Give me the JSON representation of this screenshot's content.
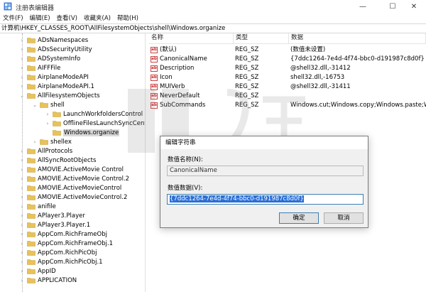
{
  "window": {
    "title": "注册表编辑器",
    "controls": {
      "minimize": "—",
      "maximize": "☐",
      "close": "✕"
    }
  },
  "menu": [
    "文件(F)",
    "编辑(E)",
    "查看(V)",
    "收藏夹(A)",
    "帮助(H)"
  ],
  "address": "计算机\\HKEY_CLASSES_ROOT\\AllFilesystemObjects\\shell\\Windows.organize",
  "tree": {
    "items": [
      {
        "label": "ADsNamespaces",
        "level": 1,
        "expand": ">"
      },
      {
        "label": "ADsSecurityUtility",
        "level": 1,
        "expand": ">"
      },
      {
        "label": "ADSystemInfo",
        "level": 1,
        "expand": ">"
      },
      {
        "label": "AIFFFile",
        "level": 1,
        "expand": ">"
      },
      {
        "label": "AirplaneModeAPI",
        "level": 1,
        "expand": ">"
      },
      {
        "label": "AirplaneModeAPI.1",
        "level": 1,
        "expand": ">"
      },
      {
        "label": "AllFilesystemObjects",
        "level": 1,
        "expand": "v"
      },
      {
        "label": "shell",
        "level": 2,
        "expand": "v"
      },
      {
        "label": "LaunchWorkfoldersControl",
        "level": 3,
        "expand": ">"
      },
      {
        "label": "OfflineFilesLaunchSyncCenter",
        "level": 3,
        "expand": ">"
      },
      {
        "label": "Windows.organize",
        "level": 3,
        "expand": "",
        "selected": true
      },
      {
        "label": "shellex",
        "level": 2,
        "expand": ">"
      },
      {
        "label": "AllProtocols",
        "level": 1,
        "expand": ">"
      },
      {
        "label": "AllSyncRootObjects",
        "level": 1,
        "expand": ">"
      },
      {
        "label": "AMOVIE.ActiveMovie Control",
        "level": 1,
        "expand": ">"
      },
      {
        "label": "AMOVIE.ActiveMovie Control.2",
        "level": 1,
        "expand": ">"
      },
      {
        "label": "AMOVIE.ActiveMovieControl",
        "level": 1,
        "expand": ">"
      },
      {
        "label": "AMOVIE.ActiveMovieControl.2",
        "level": 1,
        "expand": ">"
      },
      {
        "label": "anifile",
        "level": 1,
        "expand": ">"
      },
      {
        "label": "APlayer3.Player",
        "level": 1,
        "expand": ">"
      },
      {
        "label": "APlayer3.Player.1",
        "level": 1,
        "expand": ">"
      },
      {
        "label": "AppCom.RichFrameObj",
        "level": 1,
        "expand": ">"
      },
      {
        "label": "AppCom.RichFrameObj.1",
        "level": 1,
        "expand": ">"
      },
      {
        "label": "AppCom.RichPicObj",
        "level": 1,
        "expand": ">"
      },
      {
        "label": "AppCom.RichPicObj.1",
        "level": 1,
        "expand": ">"
      },
      {
        "label": "AppID",
        "level": 1,
        "expand": ">"
      },
      {
        "label": "APPLICATION",
        "level": 1,
        "expand": ">"
      }
    ]
  },
  "list": {
    "headers": [
      "名称",
      "类型",
      "数据"
    ],
    "rows": [
      {
        "name": "(默认)",
        "type": "REG_SZ",
        "data": "(数值未设置)"
      },
      {
        "name": "CanonicalName",
        "type": "REG_SZ",
        "data": "{7ddc1264-7e4d-4f74-bbc0-d191987c8d0f}"
      },
      {
        "name": "Description",
        "type": "REG_SZ",
        "data": "@shell32.dll,-31412"
      },
      {
        "name": "Icon",
        "type": "REG_SZ",
        "data": "shell32.dll,-16753"
      },
      {
        "name": "MUIVerb",
        "type": "REG_SZ",
        "data": "@shell32.dll,-31411"
      },
      {
        "name": "NeverDefault",
        "type": "REG_SZ",
        "data": ""
      },
      {
        "name": "SubCommands",
        "type": "REG_SZ",
        "data": "Windows.cut;Windows.copy;Windows.paste;W..."
      }
    ],
    "icon_text": "ab"
  },
  "watermark": "ithome.com",
  "dialog": {
    "title": "编辑字符串",
    "name_label": "数值名称(N):",
    "name_value": "CanonicalName",
    "data_label": "数值数据(V):",
    "data_value": "{7ddc1264-7e4d-4f74-bbc0-d191987c8d0f}",
    "ok": "确定",
    "cancel": "取消"
  },
  "colors": {
    "selection": "#2a6fd6",
    "folder": "#e8c25a",
    "accent": "#3c7fb1"
  }
}
